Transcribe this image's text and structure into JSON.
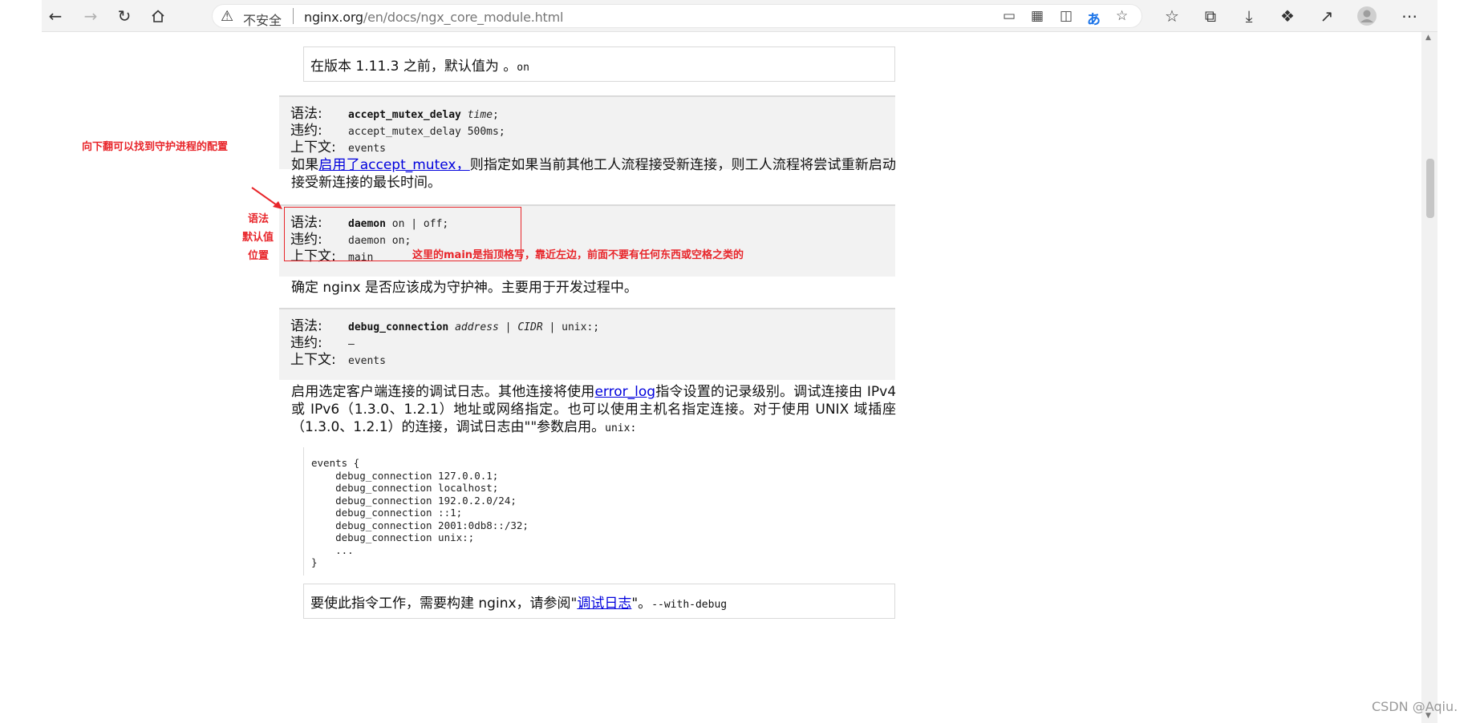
{
  "browser": {
    "security_label": "不安全",
    "url_host": "nginx.org",
    "url_path": "/en/docs/ngx_core_module.html",
    "address_icons": [
      "cast-icon",
      "apps-icon",
      "reader-icon",
      "translate-icon",
      "favorite-add-icon"
    ],
    "translate_glyph": "あ",
    "toolbar_icons": [
      "favorites-icon",
      "collections-icon",
      "download-icon",
      "extensions-icon",
      "share-icon",
      "profile-icon",
      "more-icon"
    ]
  },
  "page": {
    "note_top": {
      "text": "在版本 1.11.3 之前，默认值为 。",
      "code": "on"
    },
    "labels": {
      "syntax": "语法:",
      "default": "违约:",
      "context": "上下文:"
    },
    "directive_accept_mutex_delay": {
      "name": "accept_mutex_delay",
      "arg": "time",
      "end": ";",
      "default": "accept_mutex_delay 500ms;",
      "context": "events"
    },
    "para_accept_mutex": {
      "prefix": "如果",
      "link": "启用了accept_mutex，",
      "suffix": "则指定如果当前其他工人流程接受新连接，则工人流程将尝试重新启动接受新连接的最长时间。"
    },
    "directive_daemon": {
      "name": "daemon",
      "arg": "on | off",
      "end": ";",
      "default": "daemon on;",
      "context": "main"
    },
    "para_daemon": "确定 nginx 是否应该成为守护神。主要用于开发过程中。",
    "directive_debug_connection": {
      "name": "debug_connection",
      "arg1": "address",
      "sep1": " | ",
      "arg2": "CIDR",
      "sep2": " | ",
      "arg3": "unix:",
      "end": ";",
      "default": "—",
      "context": "events"
    },
    "para_debug": {
      "prefix": "启用选定客户端连接的调试日志。其他连接将使用",
      "link": "error_log",
      "suffix": "指令设置的记录级别。调试连接由 IPv4 或 IPv6（1.3.0、1.2.1）地址或网络指定。也可以使用主机名指定连接。对于使用 UNIX 域插座（1.3.0、1.2.1）的连接，调试日志由\"\"参数启用。",
      "code": "unix:"
    },
    "code_example": "events {\n    debug_connection 127.0.0.1;\n    debug_connection localhost;\n    debug_connection 192.0.2.0/24;\n    debug_connection ::1;\n    debug_connection 2001:0db8::/32;\n    debug_connection unix:;\n    ...\n}",
    "note_bottom": {
      "prefix": "要使此指令工作，需要构建 nginx，请参阅\"",
      "link": "调试日志",
      "suffix": "\"。",
      "code": "--with-debug"
    }
  },
  "annotations": {
    "scroll_hint": "向下翻可以找到守护进程的配置",
    "label_syntax": "语法",
    "label_default": "默认值",
    "label_position": "位置",
    "main_note": "这里的main是指顶格写，靠近左边，前面不要有任何东西或空格之类的",
    "accent_color": "#e8262b"
  },
  "watermark": "CSDN @Aqiu."
}
